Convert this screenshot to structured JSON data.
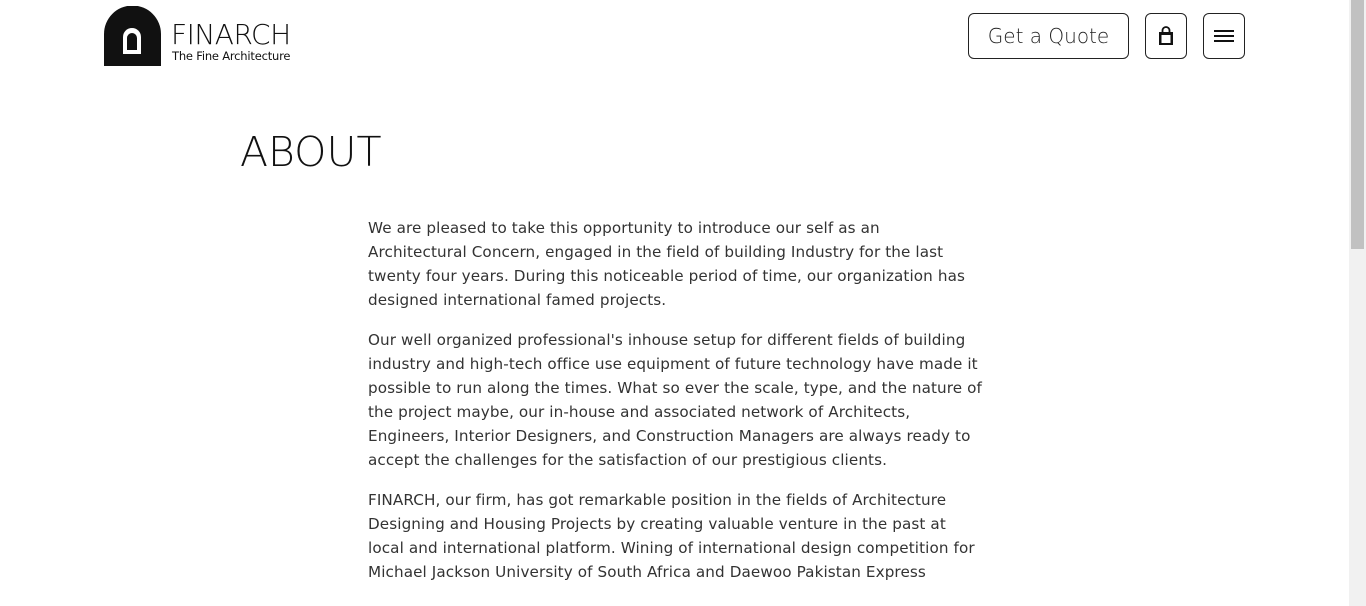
{
  "header": {
    "logo_name": "FINARCH",
    "logo_tagline": "The Fine Architecture",
    "quote_label": "Get a Quote",
    "cart_icon": "shopping-bag-icon",
    "menu_icon": "hamburger-menu-icon"
  },
  "main": {
    "title": "ABOUT",
    "paragraphs": [
      "We are pleased to take this opportunity to introduce our self as an Architectural Concern, engaged in the field of building Industry for the last twenty four years. During this noticeable period of time, our organization has designed international famed projects.",
      "Our well organized professional's inhouse setup for different fields of building industry and high-tech office use equipment of future technology have made it possible to run along the times. What so ever the scale, type, and the nature of the project maybe, our in-house and associated network of Architects, Engineers, Interior Designers, and Construction Managers are always ready to accept the challenges for the satisfaction of our prestigious clients.",
      "FINARCH, our firm, has got remarkable position in the fields of Architecture Designing and Housing Projects by creating valuable venture in the past at local and international platform. Wining of international design competition for Michael Jackson University of South Africa and Daewoo Pakistan Express"
    ]
  }
}
